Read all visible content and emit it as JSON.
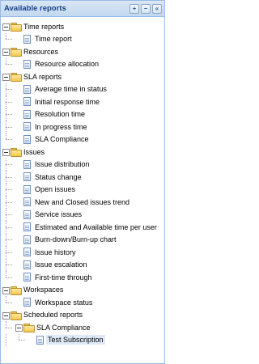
{
  "panel": {
    "title": "Available reports",
    "tools": [
      {
        "name": "expand-all-icon",
        "glyph": "+"
      },
      {
        "name": "collapse-all-icon",
        "glyph": "−"
      },
      {
        "name": "collapse-panel-icon",
        "glyph": "«"
      }
    ]
  },
  "tree": [
    {
      "label": "Time reports",
      "type": "folder",
      "depth": 0,
      "expanded": true
    },
    {
      "label": "Time report",
      "type": "report",
      "depth": 1
    },
    {
      "label": "Resources",
      "type": "folder",
      "depth": 0,
      "expanded": true
    },
    {
      "label": "Resource allocation",
      "type": "report",
      "depth": 1
    },
    {
      "label": "SLA reports",
      "type": "folder",
      "depth": 0,
      "expanded": true
    },
    {
      "label": "Average time in status",
      "type": "report",
      "depth": 1
    },
    {
      "label": "Initial response time",
      "type": "report",
      "depth": 1
    },
    {
      "label": "Resolution time",
      "type": "report",
      "depth": 1
    },
    {
      "label": "In progress time",
      "type": "report",
      "depth": 1
    },
    {
      "label": "SLA Compliance",
      "type": "report",
      "depth": 1
    },
    {
      "label": "Issues",
      "type": "folder",
      "depth": 0,
      "expanded": true
    },
    {
      "label": "Issue distribution",
      "type": "report",
      "depth": 1
    },
    {
      "label": "Status change",
      "type": "report",
      "depth": 1
    },
    {
      "label": "Open issues",
      "type": "report",
      "depth": 1
    },
    {
      "label": "New and Closed issues trend",
      "type": "report",
      "depth": 1
    },
    {
      "label": "Service issues",
      "type": "report",
      "depth": 1
    },
    {
      "label": "Estimated and Available time per user",
      "type": "report",
      "depth": 1
    },
    {
      "label": "Burn-down/Burn-up chart",
      "type": "report",
      "depth": 1
    },
    {
      "label": "Issue history",
      "type": "report",
      "depth": 1
    },
    {
      "label": "Issue escalation",
      "type": "report",
      "depth": 1
    },
    {
      "label": "First-time through",
      "type": "report",
      "depth": 1
    },
    {
      "label": "Workspaces",
      "type": "folder",
      "depth": 0,
      "expanded": true
    },
    {
      "label": "Workspace status",
      "type": "report",
      "depth": 1
    },
    {
      "label": "Scheduled reports",
      "type": "folder",
      "depth": 0,
      "expanded": true
    },
    {
      "label": "SLA Compliance",
      "type": "folder",
      "depth": 1,
      "expanded": true
    },
    {
      "label": "Test Subscription",
      "type": "report",
      "depth": 2,
      "selected": true
    }
  ]
}
